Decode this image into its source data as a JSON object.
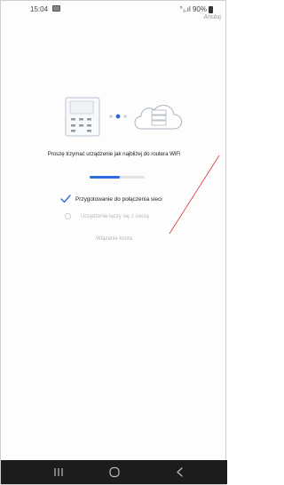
{
  "status_bar": {
    "time": "15:04",
    "signal_text": "°₁.ıl 90%"
  },
  "header": {
    "cancel_label": "Anuluj"
  },
  "illustration": {
    "device_icon": "ac-controller-icon",
    "cloud_icon": "cloud-server-icon"
  },
  "instruction": "Proszę trzymać urządzenie jak najbliżej do routera WiFi",
  "progress": {
    "fraction": 0.55,
    "color": "#2d6cde"
  },
  "steps": [
    {
      "label": "Przygotowanie do połączenia sieci",
      "status": "done"
    },
    {
      "label": "Urządzenie łączy się z siecią",
      "status": "pending"
    }
  ],
  "note": "Wiązanie konta",
  "nav": {
    "icons": [
      "recent-apps-icon",
      "home-icon",
      "back-icon"
    ]
  }
}
